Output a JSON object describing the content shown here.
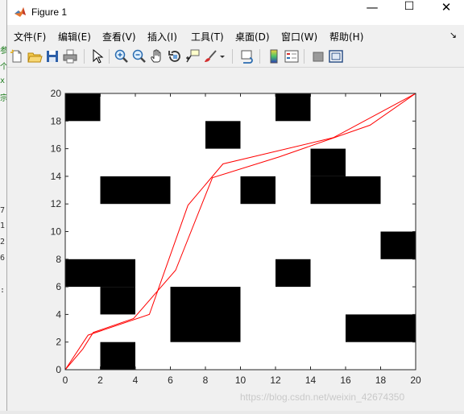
{
  "window": {
    "title": "Figure 1",
    "controls": {
      "minimize": "—",
      "maximize": "☐",
      "close": "✕"
    }
  },
  "menu": {
    "items": [
      {
        "label": "文件(F)"
      },
      {
        "label": "编辑(E)"
      },
      {
        "label": "查看(V)"
      },
      {
        "label": "插入(I)"
      },
      {
        "label": "工具(T)"
      },
      {
        "label": "桌面(D)"
      },
      {
        "label": "窗口(W)"
      },
      {
        "label": "帮助(H)"
      }
    ],
    "overflow_arrow": "↘"
  },
  "toolbar": {
    "icons": [
      "new-figure-icon",
      "open-file-icon",
      "save-icon",
      "print-icon",
      "pointer-icon",
      "zoom-in-icon",
      "zoom-out-icon",
      "pan-hand-icon",
      "rotate-3d-icon",
      "data-cursor-icon",
      "brush-icon",
      "brush-dropdown-icon",
      "link-plot-icon",
      "colorbar-icon",
      "legend-icon",
      "hide-plot-tools-icon",
      "show-plot-tools-icon"
    ]
  },
  "background_glyphs": [
    "参",
    "个",
    "x",
    "宗",
    "7",
    "1",
    "2",
    "6",
    ":"
  ],
  "watermark": "https://blog.csdn.net/weixin_42674350",
  "chart_data": {
    "type": "line",
    "title": "",
    "xlabel": "",
    "ylabel": "",
    "xlim": [
      0,
      20
    ],
    "ylim": [
      0,
      20
    ],
    "xticks": [
      0,
      2,
      4,
      6,
      8,
      10,
      12,
      14,
      16,
      18,
      20
    ],
    "yticks": [
      0,
      2,
      4,
      6,
      8,
      10,
      12,
      14,
      16,
      18,
      20
    ],
    "grid": false,
    "obstacles": [
      {
        "x": [
          0,
          2
        ],
        "y": [
          18,
          20
        ]
      },
      {
        "x": [
          12,
          14
        ],
        "y": [
          18,
          20
        ]
      },
      {
        "x": [
          8,
          10
        ],
        "y": [
          16,
          18
        ]
      },
      {
        "x": [
          14,
          16
        ],
        "y": [
          14,
          16
        ]
      },
      {
        "x": [
          2,
          6
        ],
        "y": [
          12,
          14
        ]
      },
      {
        "x": [
          10,
          12
        ],
        "y": [
          12,
          14
        ]
      },
      {
        "x": [
          14,
          18
        ],
        "y": [
          12,
          14
        ]
      },
      {
        "x": [
          18,
          20
        ],
        "y": [
          8,
          10
        ]
      },
      {
        "x": [
          0,
          4
        ],
        "y": [
          6,
          8
        ]
      },
      {
        "x": [
          12,
          14
        ],
        "y": [
          6,
          8
        ]
      },
      {
        "x": [
          2,
          4
        ],
        "y": [
          4,
          6
        ]
      },
      {
        "x": [
          6,
          10
        ],
        "y": [
          2,
          6
        ]
      },
      {
        "x": [
          16,
          20
        ],
        "y": [
          2,
          4
        ]
      },
      {
        "x": [
          2,
          4
        ],
        "y": [
          0,
          2
        ]
      }
    ],
    "series": [
      {
        "color": "#ff0000",
        "x": [
          0,
          1.0,
          1.6,
          3.9,
          6.3,
          8.4,
          12.2,
          17.4,
          20
        ],
        "y": [
          0,
          1.5,
          2.7,
          3.7,
          7.2,
          13.9,
          15.4,
          17.7,
          20
        ]
      },
      {
        "color": "#ff0000",
        "x": [
          0,
          1.3,
          4.8,
          7.0,
          9.0,
          15.3,
          20
        ],
        "y": [
          0,
          2.5,
          4.0,
          11.9,
          14.9,
          16.8,
          20
        ]
      }
    ]
  }
}
